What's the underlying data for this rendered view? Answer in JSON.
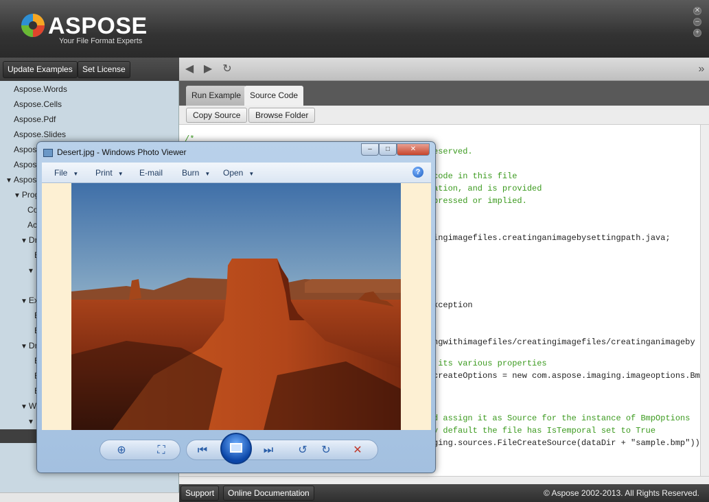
{
  "app": {
    "brand": "ASPOSE",
    "tagline": "Your File Format Experts",
    "window_buttons": [
      "✕",
      "–",
      "+"
    ]
  },
  "left_panel": {
    "update_examples_label": "Update Examples",
    "set_license_label": "Set License",
    "tree_items": [
      {
        "label": "Aspose.Words",
        "expanded": false
      },
      {
        "label": "Aspose.Cells",
        "expanded": false
      },
      {
        "label": "Aspose.Pdf",
        "expanded": false
      },
      {
        "label": "Aspose.Slides",
        "expanded": false
      },
      {
        "label": "Aspos",
        "expanded": false
      },
      {
        "label": "Aspos",
        "expanded": false
      },
      {
        "label": "Aspos",
        "expanded": true
      },
      {
        "label": "Prog",
        "expanded": true
      },
      {
        "label": "Co",
        "expanded": false
      },
      {
        "label": "Ac",
        "expanded": false
      },
      {
        "label": "Dr",
        "expanded": true
      },
      {
        "label": "E",
        "expanded": false
      },
      {
        "label": "",
        "expanded": true
      },
      {
        "label": "Ex",
        "expanded": true
      },
      {
        "label": "E",
        "expanded": false
      },
      {
        "label": "E",
        "expanded": false
      },
      {
        "label": "Dr",
        "expanded": true
      },
      {
        "label": "E",
        "expanded": false
      },
      {
        "label": "E",
        "expanded": false
      },
      {
        "label": "E",
        "expanded": false
      },
      {
        "label": "Wo",
        "expanded": true
      },
      {
        "label": "",
        "expanded": true
      }
    ]
  },
  "main": {
    "nav": {
      "back": "◀",
      "forward": "▶",
      "refresh": "↻",
      "more": "»"
    },
    "tabs": [
      {
        "label": "Run Example",
        "active": false
      },
      {
        "label": "Source Code",
        "active": true
      }
    ],
    "copy_source_label": "Copy Source",
    "browse_folder_label": "Browse Folder",
    "code_lines": [
      {
        "text": "/*",
        "kind": "comment"
      },
      {
        "text": "eserved.",
        "kind": "comment"
      },
      {
        "text": "code in this file",
        "kind": "comment"
      },
      {
        "text": "ation, and is provided",
        "kind": "comment"
      },
      {
        "text": "pressed or implied.",
        "kind": "comment"
      },
      {
        "text": "ingimagefiles.creatinganimagebysettingpath.java;",
        "kind": "code"
      },
      {
        "text": "xception",
        "kind": "code"
      },
      {
        "text": "ngwithimagefiles/creatingimagefiles/creatinganimageby",
        "kind": "code"
      },
      {
        "text": " its various properties",
        "kind": "comment"
      },
      {
        "text": "createOptions = new com.aspose.imaging.imageoptions.Bm",
        "kind": "code"
      },
      {
        "text": "d assign it as Source for the instance of BmpOptions",
        "kind": "comment"
      },
      {
        "text": "y default the file has IsTemporal set to True",
        "kind": "comment"
      },
      {
        "text": "ging.sources.FileCreateSource(dataDir + \"sample.bmp\"));",
        "kind": "code"
      }
    ]
  },
  "footer": {
    "support_label": "Support",
    "docs_label": "Online Documentation",
    "copyright": "© Aspose 2002-2013. All Rights Reserved."
  },
  "photo_viewer": {
    "title": "Desert.jpg - Windows Photo Viewer",
    "menus": [
      "File",
      "Print",
      "E-mail",
      "Burn",
      "Open"
    ],
    "help": "?",
    "caption_buttons": {
      "minimize": "–",
      "maximize": "□",
      "close": "✕"
    }
  }
}
